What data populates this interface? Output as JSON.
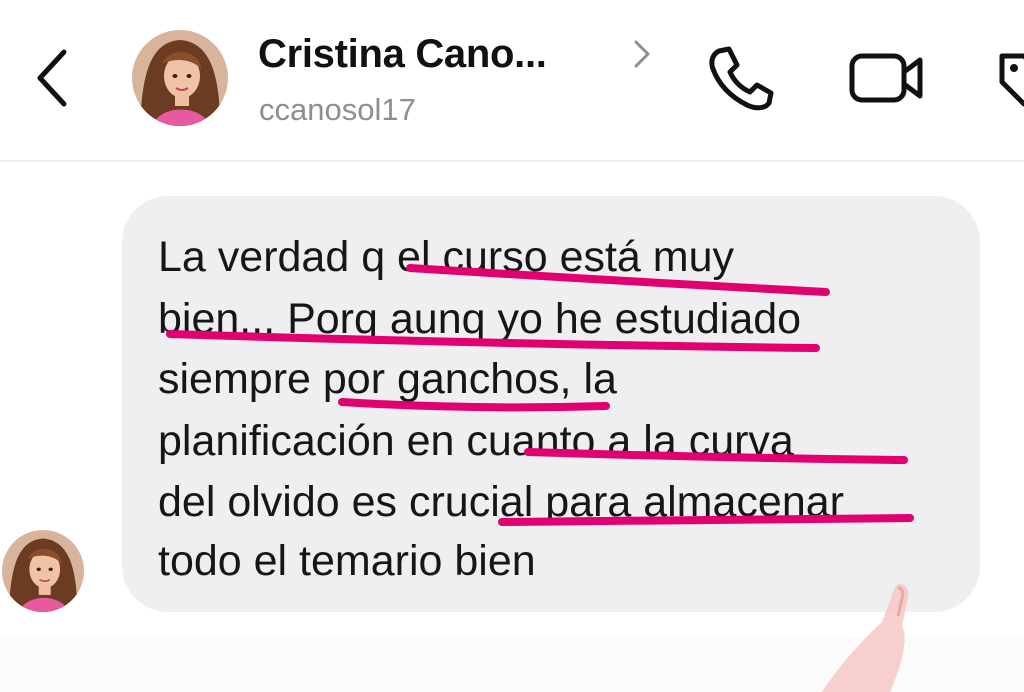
{
  "header": {
    "contact_name": "Cristina Cano...",
    "contact_handle": "ccanosol17",
    "icons": {
      "back": "chevron-left-icon",
      "name_chevron": "chevron-right-icon",
      "phone": "phone-icon",
      "video": "video-camera-icon",
      "tag": "tag-icon"
    }
  },
  "message": {
    "lines": [
      "La verdad q el curso está muy",
      "bien... Porq aunq yo he estudiado",
      "siempre por ganchos, la",
      "planificación en cuanto a la curva",
      "del olvido es crucial para almacenar",
      "todo el temario bien"
    ]
  },
  "colors": {
    "bubble": "#efeff1",
    "underline": "#e0006f",
    "handle": "#8e8e93",
    "text": "#161616"
  }
}
